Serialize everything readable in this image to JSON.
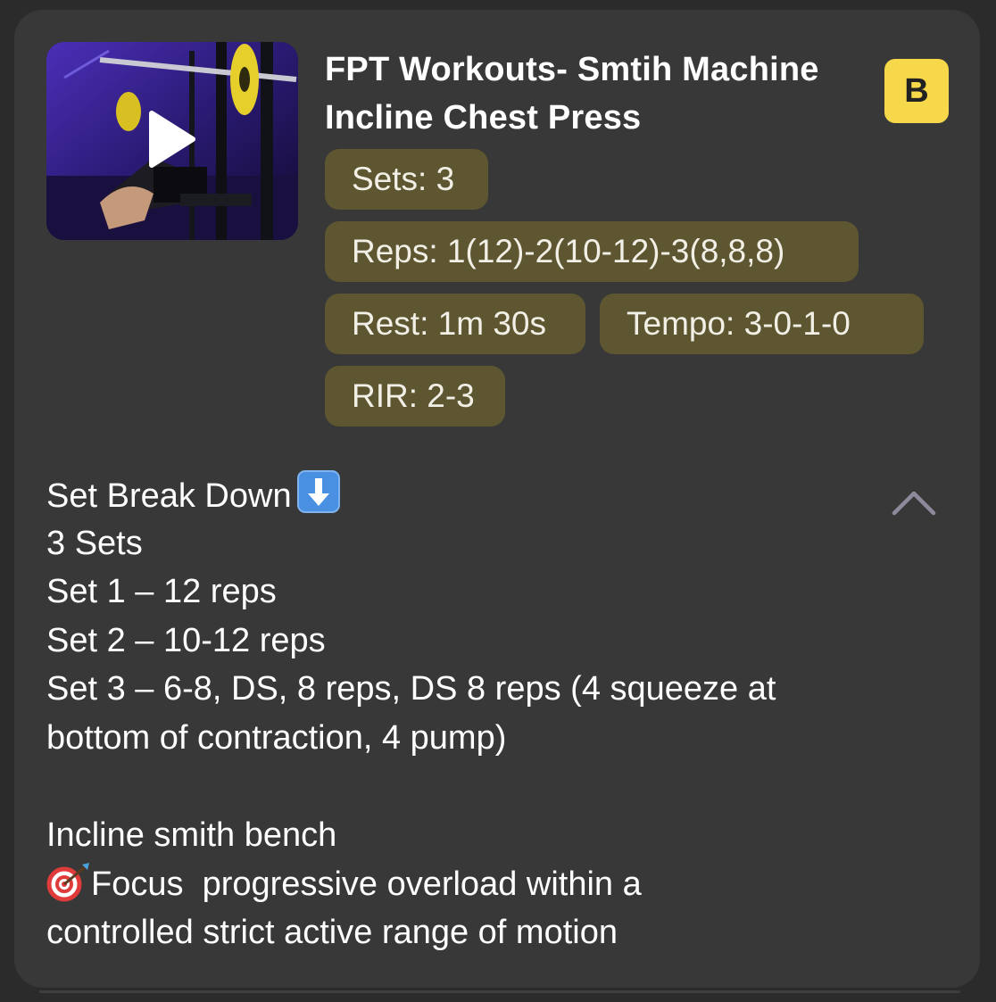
{
  "exercise": {
    "title_line1": "FPT Workouts- Smtih Machine",
    "title_line2": "Incline Chest Press",
    "badge": "B",
    "thumbnail_icon": "play-icon"
  },
  "chips": {
    "sets": "Sets: 3",
    "reps": "Reps: 1(12)-2(10-12)-3(8,8,8)",
    "rest": "Rest: 1m 30s",
    "tempo": "Tempo: 3-0-1-0",
    "rir": "RIR: 2-3"
  },
  "description": {
    "heading": "Set Break Down",
    "heading_icon": "down-arrow-emoji",
    "lines": [
      "3 Sets",
      "Set 1 – 12 reps",
      "Set 2 – 10-12 reps",
      "Set 3 – 6-8, DS, 8 reps, DS 8 reps (4 squeeze at",
      "bottom of contraction, 4 pump)",
      "",
      "Incline smith bench"
    ],
    "focus_icon": "target-emoji",
    "focus_line1": "Focus  progressive overload within a",
    "focus_line2": "controlled strict active range of motion"
  },
  "controls": {
    "collapse_icon": "chevron-up-icon"
  },
  "colors": {
    "background": "#2b2b2b",
    "card": "#383838",
    "chip": "#5e5631",
    "badge": "#f6d84a"
  }
}
